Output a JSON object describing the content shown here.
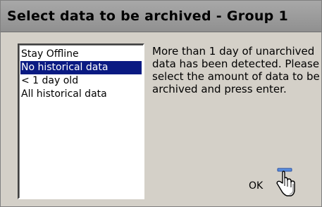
{
  "dialog": {
    "title": "Select data to be archived - Group 1",
    "options": [
      {
        "label": "Stay Offline",
        "selected": false
      },
      {
        "label": "No historical data",
        "selected": true
      },
      {
        "label": "< 1 day old",
        "selected": false
      },
      {
        "label": "All historical data",
        "selected": false
      }
    ],
    "message": "More than 1 day of unarchived data has been detected. Please select the amount of data to be archived and press enter.",
    "ok_label": "OK",
    "ok_icon": "hand-pointer-icon",
    "selection_color": "#0a1a82",
    "title_bar_color": "#9c9c9c"
  }
}
